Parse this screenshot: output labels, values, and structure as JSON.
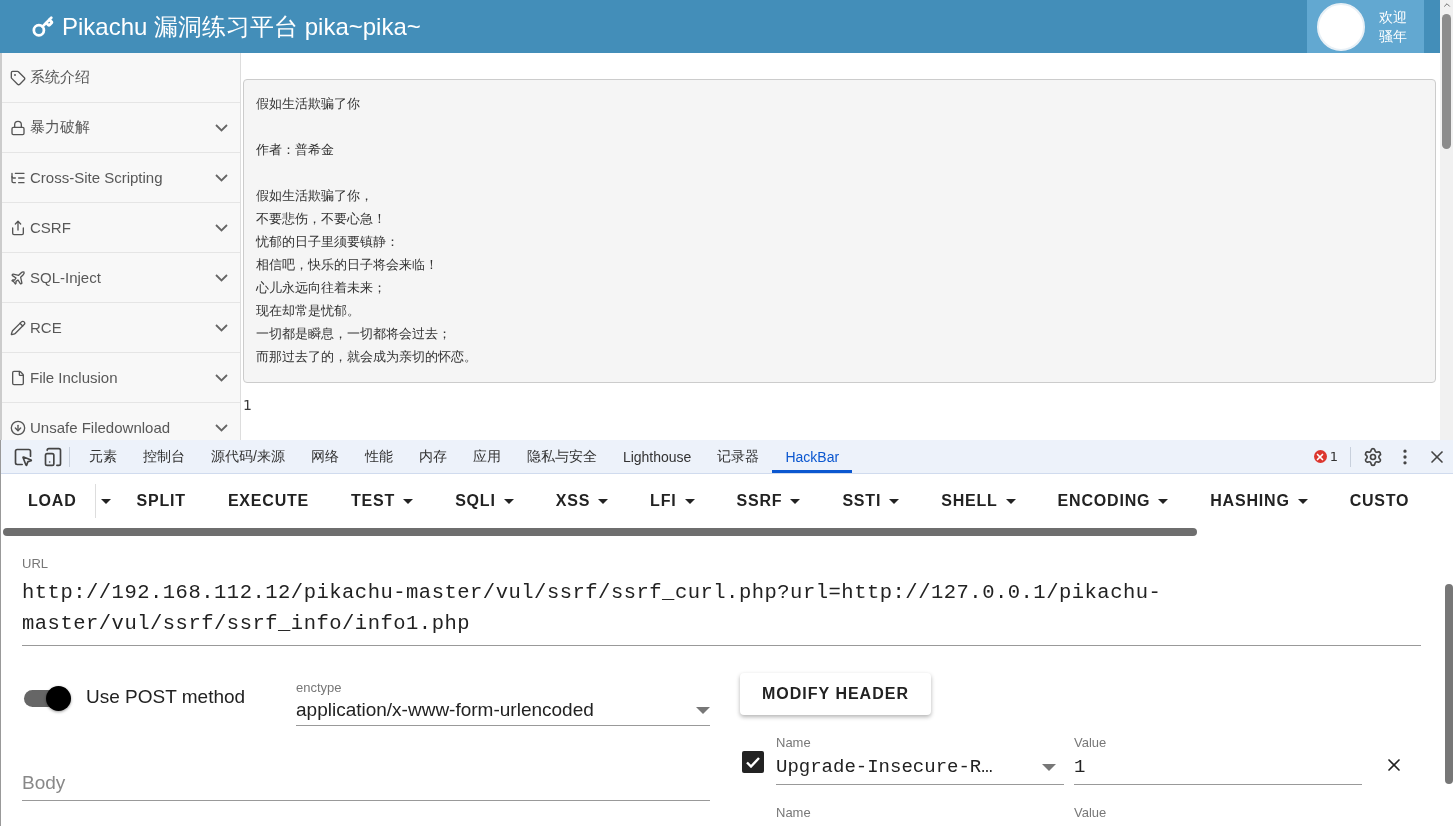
{
  "header": {
    "title": "Pikachu 漏洞练习平台 pika~pika~",
    "greeting": "欢迎",
    "user": "骚年"
  },
  "sidebar": {
    "items": [
      {
        "label": "系统介绍",
        "expandable": false
      },
      {
        "label": "暴力破解",
        "expandable": true
      },
      {
        "label": "Cross-Site Scripting",
        "expandable": true
      },
      {
        "label": "CSRF",
        "expandable": true
      },
      {
        "label": "SQL-Inject",
        "expandable": true
      },
      {
        "label": "RCE",
        "expandable": true
      },
      {
        "label": "File Inclusion",
        "expandable": true
      },
      {
        "label": "Unsafe Filedownload",
        "expandable": true
      }
    ]
  },
  "content": {
    "poem_title": "假如生活欺骗了你",
    "author": "作者：普希金",
    "lines": [
      "假如生活欺骗了你，",
      "不要悲伤，不要心急！",
      "忧郁的日子里须要镇静：",
      "相信吧，快乐的日子将会来临！",
      "心儿永远向往着未来；",
      "现在却常是忧郁。",
      "一切都是瞬息，一切都将会过去；",
      "而那过去了的，就会成为亲切的怀恋。"
    ],
    "output": "1"
  },
  "devtools": {
    "tabs": [
      {
        "label": "元素",
        "selected": false
      },
      {
        "label": "控制台",
        "selected": false
      },
      {
        "label": "源代码/来源",
        "selected": false
      },
      {
        "label": "网络",
        "selected": false
      },
      {
        "label": "性能",
        "selected": false
      },
      {
        "label": "内存",
        "selected": false
      },
      {
        "label": "应用",
        "selected": false
      },
      {
        "label": "隐私与安全",
        "selected": false
      },
      {
        "label": "Lighthouse",
        "selected": false
      },
      {
        "label": "记录器",
        "selected": false
      },
      {
        "label": "HackBar",
        "selected": true
      }
    ],
    "error_count": "1"
  },
  "hackbar": {
    "menu": [
      {
        "label": "LOAD",
        "kind": "split"
      },
      {
        "label": "SPLIT",
        "kind": "plain"
      },
      {
        "label": "EXECUTE",
        "kind": "plain"
      },
      {
        "label": "TEST",
        "kind": "menu"
      },
      {
        "label": "SQLI",
        "kind": "menu"
      },
      {
        "label": "XSS",
        "kind": "menu"
      },
      {
        "label": "LFI",
        "kind": "menu"
      },
      {
        "label": "SSRF",
        "kind": "menu"
      },
      {
        "label": "SSTI",
        "kind": "menu"
      },
      {
        "label": "SHELL",
        "kind": "menu"
      },
      {
        "label": "ENCODING",
        "kind": "menu"
      },
      {
        "label": "HASHING",
        "kind": "menu"
      },
      {
        "label": "CUSTO",
        "kind": "plain"
      }
    ],
    "url": {
      "label": "URL",
      "value": "http://192.168.112.12/pikachu-master/vul/ssrf/ssrf_curl.php?url=http://127.0.0.1/pikachu-master/vul/ssrf/ssrf_info/info1.php"
    },
    "post": {
      "label": "Use POST method",
      "on": true
    },
    "enctype": {
      "label": "enctype",
      "value": "application/x-www-form-urlencoded"
    },
    "body": {
      "placeholder": "Body"
    },
    "modify_header": "MODIFY HEADER",
    "headers": [
      {
        "checked": true,
        "name_label": "Name",
        "name": "Upgrade-Insecure-R…",
        "value_label": "Value",
        "value": "1"
      },
      {
        "name_label": "Name",
        "value_label": "Value"
      }
    ]
  }
}
